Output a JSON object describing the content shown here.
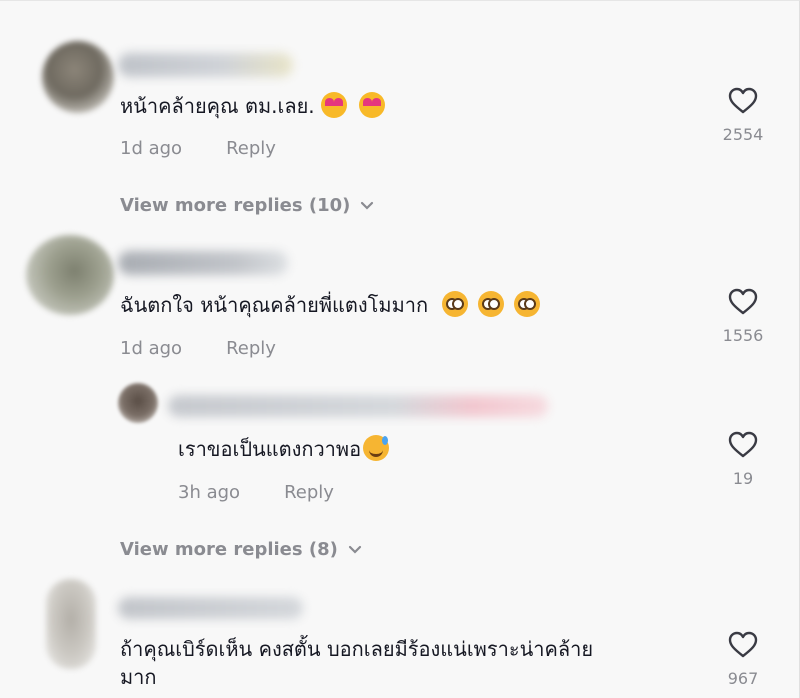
{
  "comments": [
    {
      "text": "หน้าคล้ายคุณ ตม.เลย.",
      "emoji": [
        "smiling-face-with-hearts",
        "smiling-face-with-hearts"
      ],
      "time": "1d ago",
      "reply_label": "Reply",
      "likes": "2554",
      "view_more": "View more replies (10)"
    },
    {
      "text": "ฉันตกใจ หน้าคุณคล้ายพี่แตงโมมาก",
      "emoji": [
        "flushed-face",
        "flushed-face",
        "flushed-face"
      ],
      "time": "1d ago",
      "reply_label": "Reply",
      "likes": "1556",
      "reply": {
        "text": "เราขอเป็นแตงกวาพอ",
        "emoji": [
          "grinning-face-with-sweat"
        ],
        "time": "3h ago",
        "reply_label": "Reply",
        "likes": "19"
      },
      "view_more": "View more replies (8)"
    },
    {
      "text_line1": "ถ้าคุณเบิร์ดเห็น คงสตั้น บอกเลยมีร้องแน่เพราะน่าคล้าย",
      "text_line2": "มาก",
      "time": "",
      "likes": "967"
    }
  ],
  "icons": {
    "like": "heart-outline-icon",
    "expand": "chevron-down-icon"
  },
  "colors": {
    "text": "#161823",
    "muted": "#8a8b91",
    "background": "#f8f8f8"
  }
}
